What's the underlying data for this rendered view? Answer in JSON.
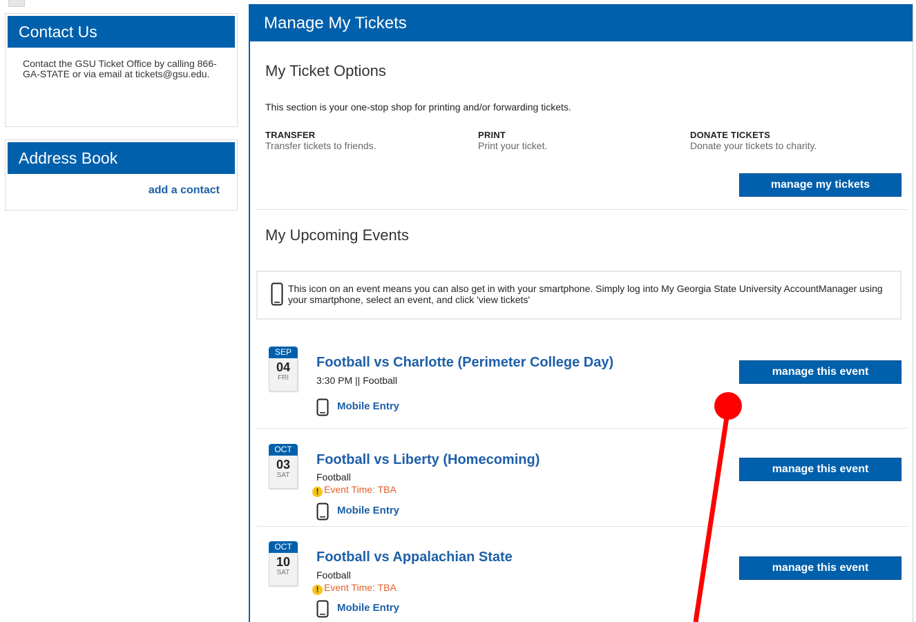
{
  "contact": {
    "title": "Contact Us",
    "text": "Contact the GSU Ticket Office by calling 866-GA-STATE or via email at tickets@gsu.edu."
  },
  "address_book": {
    "title": "Address Book",
    "add_contact": "add a contact"
  },
  "main": {
    "title": "Manage My Tickets",
    "options": {
      "title": "My Ticket Options",
      "description": "This section is your one-stop shop for printing and/or forwarding tickets.",
      "items": [
        {
          "title": "TRANSFER",
          "desc": "Transfer tickets to friends."
        },
        {
          "title": "PRINT",
          "desc": "Print your ticket."
        },
        {
          "title": "DONATE TICKETS",
          "desc": "Donate your tickets to charity."
        }
      ],
      "button": "manage my tickets"
    },
    "upcoming": {
      "title": "My Upcoming Events",
      "notice": "This icon on an event means you can also get in with your smartphone. Simply log into My Georgia State University AccountManager using your smartphone, select an event, and click 'view tickets'",
      "events": [
        {
          "month": "SEP",
          "day": "04",
          "dow": "FRI",
          "title": "Football vs Charlotte (Perimeter College Day)",
          "subtitle": "3:30 PM || Football",
          "warning": "",
          "mobile": "Mobile Entry",
          "button": "manage this event"
        },
        {
          "month": "OCT",
          "day": "03",
          "dow": "SAT",
          "title": "Football vs Liberty (Homecoming)",
          "subtitle": "Football",
          "warning": "Event Time: TBA",
          "mobile": "Mobile Entry",
          "button": "manage this event"
        },
        {
          "month": "OCT",
          "day": "10",
          "dow": "SAT",
          "title": "Football vs Appalachian State",
          "subtitle": "Football",
          "warning": "Event Time: TBA",
          "mobile": "Mobile Entry",
          "button": "manage this event"
        }
      ]
    }
  },
  "colors": {
    "brand_blue": "#0060ac",
    "link_blue": "#1d5fa8",
    "warning_orange": "#e2602a",
    "annotation_red": "#ff0000"
  }
}
